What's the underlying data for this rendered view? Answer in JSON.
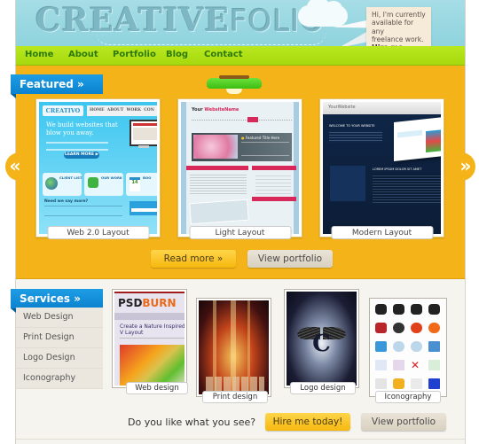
{
  "header": {
    "logo_bold": "CREATIVE",
    "logo_light": "FOLIO",
    "note_lines": [
      "Hi, I'm currently",
      "available for any",
      "freelance work."
    ],
    "note_cta": "Hire me today!"
  },
  "nav": {
    "items": [
      {
        "label": "Home"
      },
      {
        "label": "About"
      },
      {
        "label": "Portfolio"
      },
      {
        "label": "Blog"
      },
      {
        "label": "Contact"
      }
    ]
  },
  "featured": {
    "title": "Featured »",
    "prev_icon": "«",
    "next_icon": "»",
    "slides": [
      {
        "caption": "Web 2.0 Layout",
        "mock": {
          "logo": "CREATIVO",
          "menu": [
            "HOME",
            "ABOUT",
            "WORK",
            "CON"
          ],
          "headline": "We build websites that blow you away.",
          "button": "LEARN MORE ▶",
          "boxes": [
            "CLIENT LIST",
            "OUR WORK",
            "BOO"
          ],
          "footer_heading": "Need we say more?"
        }
      },
      {
        "caption": "Light Layout",
        "mock": {
          "logo_dark": "Your ",
          "logo_accent": "WebsiteName",
          "featured_title": "Featured Title Here"
        }
      },
      {
        "caption": "Modern Layout",
        "mock": {
          "logo": "YourWebsite",
          "welcome": "WELCOME TO YOUR WEBSITE",
          "lorem": "LOREM IPSUM DOLOR SIT AMET"
        }
      }
    ],
    "read_more": "Read more »",
    "view_portfolio": "View portfolio"
  },
  "services": {
    "title": "Services »",
    "items": [
      {
        "label": "Web Design"
      },
      {
        "label": "Print Design"
      },
      {
        "label": "Logo Design"
      },
      {
        "label": "Iconography"
      }
    ],
    "thumbs": [
      {
        "caption": "Web design",
        "mock_logo": "PSD",
        "mock_logo2": "BURN",
        "mock_title": "Create a Nature Inspired V Layout"
      },
      {
        "caption": "Print design"
      },
      {
        "caption": "Logo design",
        "mock_letter": "C"
      },
      {
        "caption": "Iconography"
      }
    ]
  },
  "cta": {
    "question": "Do you like what you see?",
    "hire": "Hire me today!",
    "view_portfolio": "View portfolio"
  },
  "colors": {
    "sky": "#9ad8e1",
    "nav_green": "#b0e316",
    "featured_orange": "#f4b419",
    "ribbon_blue": "#158fda",
    "nav_text": "#2e7a0c"
  }
}
